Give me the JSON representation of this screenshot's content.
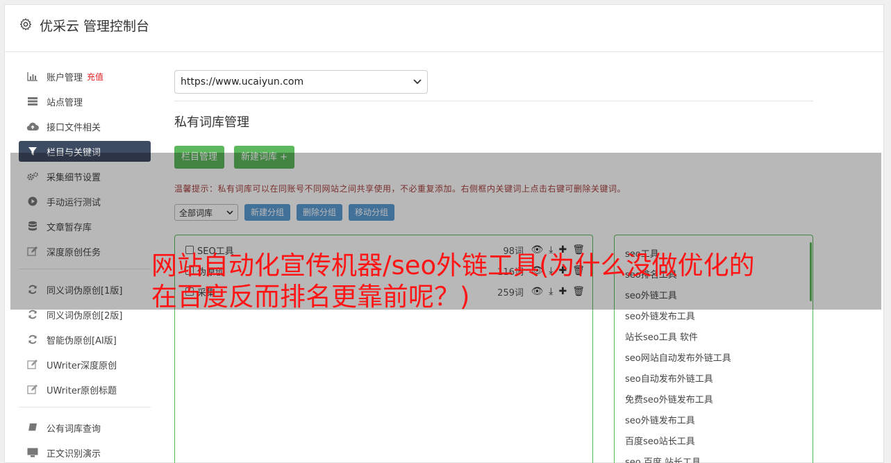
{
  "header": {
    "title": "优采云 管理控制台"
  },
  "sidebar": {
    "items": [
      {
        "label": "账户管理",
        "tag": "充值",
        "icon": "bar-chart-icon"
      },
      {
        "label": "站点管理",
        "icon": "server-icon"
      },
      {
        "label": "接口文件相关",
        "icon": "cloud-upload-icon"
      },
      {
        "label": "栏目与关键词",
        "icon": "filter-icon",
        "active": true
      },
      {
        "label": "采集细节设置",
        "icon": "gears-icon"
      },
      {
        "label": "手动运行测试",
        "icon": "play-circle-icon"
      },
      {
        "label": "文章暂存库",
        "icon": "database-icon"
      },
      {
        "label": "深度原创任务",
        "icon": "edit-icon"
      }
    ],
    "items2": [
      {
        "label": "同义词伪原创[1版]",
        "icon": "refresh-icon"
      },
      {
        "label": "同义词伪原创[2版]",
        "icon": "refresh-icon"
      },
      {
        "label": "智能伪原创[AI版]",
        "icon": "refresh-icon"
      },
      {
        "label": "UWriter深度原创",
        "icon": "edit-icon"
      },
      {
        "label": "UWriter原创标题",
        "icon": "edit-icon"
      }
    ],
    "items3": [
      {
        "label": "公有词库查询",
        "icon": "book-icon"
      },
      {
        "label": "正文识别演示",
        "icon": "desktop-icon"
      }
    ]
  },
  "main": {
    "site_select": "https://www.ucaiyun.com",
    "section_title": "私有词库管理",
    "buttons": {
      "column_manage": "栏目管理",
      "new_library": "新建词库 +"
    },
    "tip": "温馨提示：私有词库可以在同账号不同网站之间共享使用，不必重复添加。右侧框内关键词上点击右键可删除关键词。",
    "filter_select": "全部词库",
    "group_buttons": {
      "new_group": "新建分组",
      "delete_group": "删除分组",
      "move_group": "移动分组"
    },
    "libraries": [
      {
        "name": "SEO工具",
        "count": "98词"
      },
      {
        "name": "伪原创",
        "count": "116词"
      },
      {
        "name": "采集",
        "count": "259词"
      }
    ],
    "keywords": [
      "seo工具",
      "seo排名工具",
      "seo外链工具",
      "seo外链发布工具",
      "站长seo工具 软件",
      "seo网站自动发布外链工具",
      "seo自动发布外链工具",
      "免费seo外链发布工具",
      "seo外链发布工具",
      "百度seo站长工具",
      "seo 百度 站长工具"
    ]
  },
  "headline": "网站自动化宣传机器/seo外链工具(为什么没做优化的在百度反而排名更靠前呢？)",
  "colors": {
    "accent_green": "#5cb85c",
    "accent_blue": "#5a9bd5",
    "nav_active": "#3d4b63",
    "headline_red": "#ff1515"
  }
}
